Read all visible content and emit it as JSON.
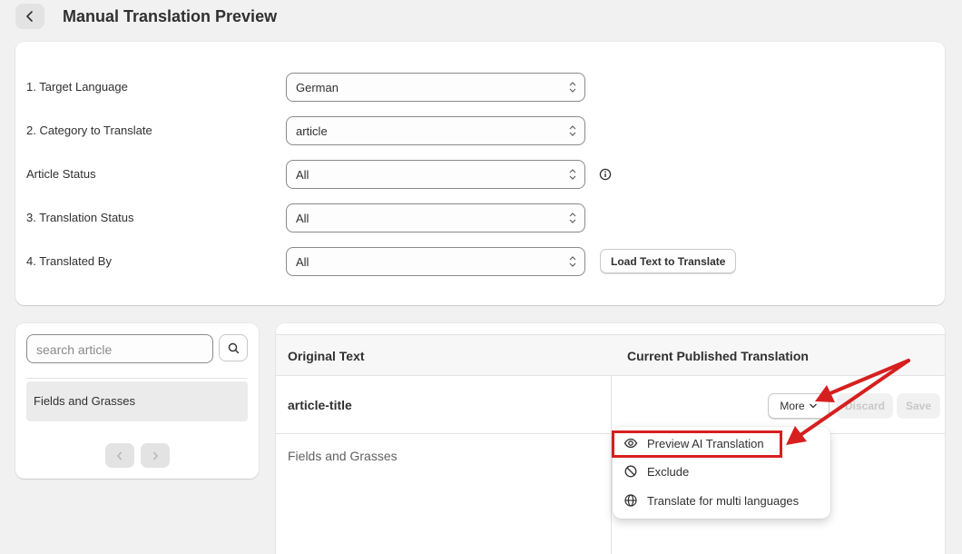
{
  "header": {
    "title": "Manual Translation Preview"
  },
  "settings": {
    "rows": [
      {
        "label": "1. Target Language",
        "value": "German"
      },
      {
        "label": "2. Category to Translate",
        "value": "article"
      },
      {
        "label": "Article Status",
        "value": "All"
      },
      {
        "label": "3. Translation Status",
        "value": "All"
      },
      {
        "label": "4. Translated By",
        "value": "All"
      }
    ],
    "load_button": "Load Text to Translate"
  },
  "sidebar": {
    "search_placeholder": "search article",
    "items": [
      {
        "label": "Fields and Grasses"
      }
    ]
  },
  "table": {
    "columns": [
      "Original Text",
      "Current Published Translation"
    ],
    "row_key": "article-title",
    "original_text": "Fields and Grasses",
    "more_label": "More",
    "discard_label": "Discard",
    "save_label": "Save"
  },
  "dropdown": {
    "items": [
      {
        "label": "Preview AI Translation",
        "icon": "eye-icon"
      },
      {
        "label": "Exclude",
        "icon": "block-icon"
      },
      {
        "label": "Translate for multi languages",
        "icon": "globe-icon"
      }
    ]
  },
  "colors": {
    "annotation_red": "#d61f1f",
    "background": "#f1f1f1",
    "card": "#ffffff"
  }
}
